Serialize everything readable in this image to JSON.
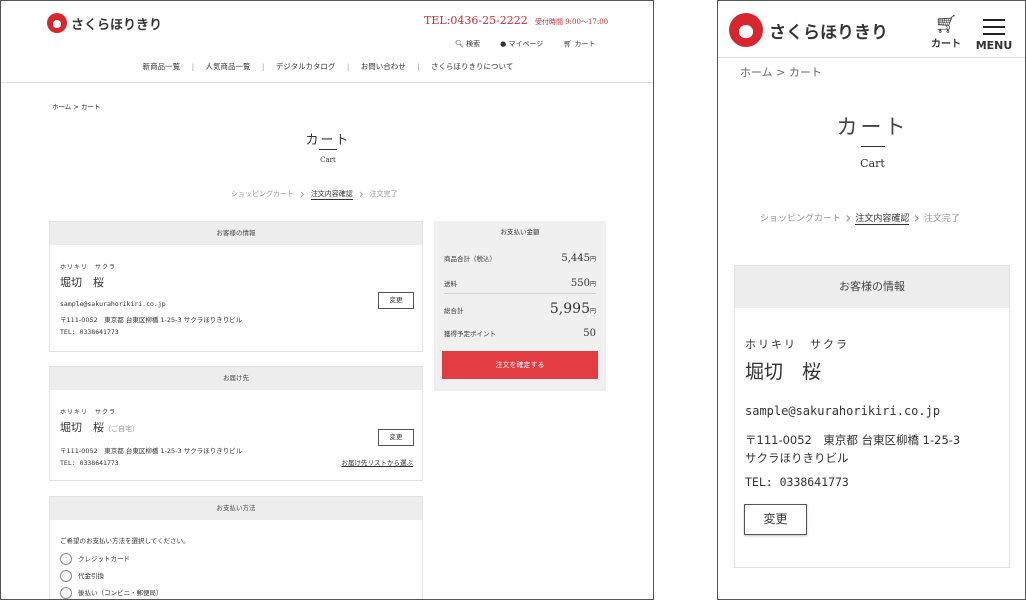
{
  "brand": {
    "name": "さくらほりきり",
    "accent": "#d8262f"
  },
  "desktop": {
    "tel": "TEL:0436-25-2222",
    "hours": "受付時間 9:00～17:00",
    "util": {
      "search": "検索",
      "mypage": "マイページ",
      "cart": "カート"
    },
    "nav": [
      "新商品一覧",
      "人気商品一覧",
      "デジタルカタログ",
      "お問い合わせ",
      "さくらほりきりについて"
    ],
    "nav_sep": "|",
    "breadcrumb": "ホーム > カート",
    "page_title": "カート",
    "page_subtitle": "Cart",
    "steps": [
      "ショッピングカート",
      "注文内容確認",
      "注文完了"
    ],
    "customer": {
      "heading": "お客様の情報",
      "kana": "ホリキリ　サクラ",
      "name": "堀切　桜",
      "email": "sample@sakurahorikiri.co.jp",
      "address": "〒111-0052　東京都 台東区柳橋 1-25-3 サクラほりきりビル",
      "tel": "TEL: 0338641773",
      "change": "変更"
    },
    "shipping": {
      "heading": "お届け先",
      "kana": "ホリキリ　サクラ",
      "name": "堀切　桜",
      "suffix": "（ご自宅）",
      "address": "〒111-0052　東京都 台東区柳橋 1-25-3 サクラほりきりビル",
      "tel": "TEL: 0338641773",
      "change": "変更",
      "list_link": "お届け先リストから選ぶ"
    },
    "payment": {
      "heading": "お支払い方法",
      "prompt": "ご希望のお支払い方法を選択してください。",
      "options": [
        "クレジットカード",
        "代金引換",
        "後払い（コンビニ・郵便局）"
      ]
    },
    "summary": {
      "heading": "お支払い金額",
      "subtotal_label": "商品合計（税込）",
      "subtotal_value": "5,445",
      "yen": "円",
      "shipping_label": "送料",
      "shipping_value": "550",
      "total_label": "総合計",
      "total_value": "5,995",
      "points_label": "獲得予定ポイント",
      "points_value": "50",
      "confirm_button": "注文を確定する"
    }
  },
  "mobile": {
    "cart_label": "カート",
    "menu_label": "MENU",
    "breadcrumb": "ホーム > カート",
    "page_title": "カート",
    "page_subtitle": "Cart",
    "steps": [
      "ショッピングカート",
      "注文内容確認",
      "注文完了"
    ],
    "customer": {
      "heading": "お客様の情報",
      "kana": "ホリキリ　サクラ",
      "name": "堀切　桜",
      "email": "sample@sakurahorikiri.co.jp",
      "address_1": "〒111-0052　東京都 台東区柳橋 1-25-3",
      "address_2": "サクラほりきりビル",
      "tel": "TEL: 0338641773",
      "change": "変更"
    }
  }
}
